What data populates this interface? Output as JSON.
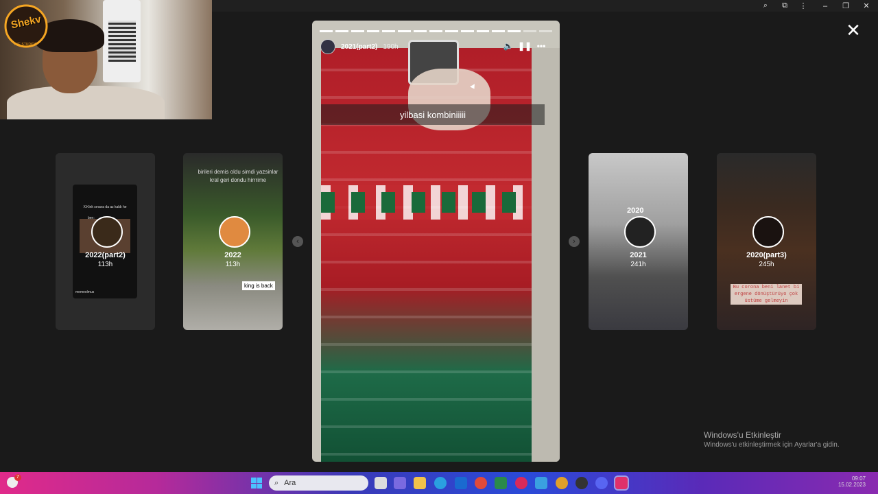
{
  "window": {
    "controls": [
      "search-icon",
      "extensions-icon",
      "more-icon",
      "minimize-icon",
      "restore-icon",
      "close-window-icon"
    ]
  },
  "webcam": {
    "logo_text": "Shekv",
    "logo_sub": "THE STUDIOS"
  },
  "viewer": {
    "close_icon": "close-icon"
  },
  "stories_left": [
    {
      "title": "2022(part2)",
      "age": "113h",
      "inner_text": "X:Kink sınava da az kaldı he",
      "inner_sub": "ben:",
      "footer": "memeolmus"
    },
    {
      "title": "2022",
      "age": "113h",
      "inner_text": "birileri demis oldu simdi yazsinlar kral geri dondu hirrrime",
      "sticker": "king is back"
    }
  ],
  "stories_right": [
    {
      "title": "2021",
      "age": "241h",
      "inner_text": "2020"
    },
    {
      "title": "2020(part3)",
      "age": "245h",
      "inner_text": "Bu corona beni lanet bi ergene dönüştürüyo çok üstüme gelmeyin"
    }
  ],
  "current_story": {
    "username": "2021(part2)",
    "age": "190h",
    "caption": "yilbasi kombiniiiii",
    "segments_total": 15,
    "segments_done": 13,
    "controls": {
      "mute": "volume-icon",
      "pause": "pause-icon",
      "more": "more-options-icon"
    }
  },
  "watermark": {
    "title": "Windows'u Etkinleştir",
    "subtitle": "Windows'u etkinleştirmek için Ayarlar'a gidin."
  },
  "taskbar": {
    "search_placeholder": "Ara",
    "notification_count": "7",
    "time": "09:07",
    "date": "15.02.2023"
  }
}
